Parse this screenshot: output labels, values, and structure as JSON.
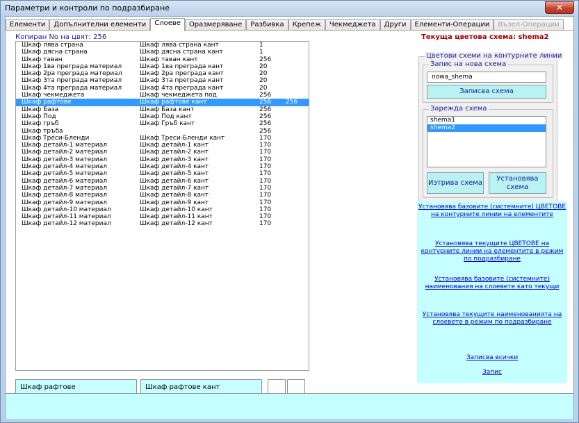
{
  "window": {
    "title": "Параметри и контроли по подразбиране",
    "close_label": "✕"
  },
  "tabs": [
    {
      "label": "Елементи",
      "active": false,
      "disabled": false
    },
    {
      "label": "Допълнителни елементи",
      "active": false,
      "disabled": false
    },
    {
      "label": "Слоеве",
      "active": true,
      "disabled": false
    },
    {
      "label": "Оразмеряване",
      "active": false,
      "disabled": false
    },
    {
      "label": "Разбивка",
      "active": false,
      "disabled": false
    },
    {
      "label": "Крепеж",
      "active": false,
      "disabled": false
    },
    {
      "label": "Чекмеджета",
      "active": false,
      "disabled": false
    },
    {
      "label": "Други",
      "active": false,
      "disabled": false
    },
    {
      "label": "Елементи-Операции",
      "active": false,
      "disabled": false
    },
    {
      "label": "Възел-Операции",
      "active": false,
      "disabled": true
    }
  ],
  "copied_label": "Копиран No на цвят:  256",
  "layers": [
    {
      "name": "Шкаф лява страна",
      "edge": "Шкаф лява страна кант",
      "color": "1",
      "copied": ""
    },
    {
      "name": "Шкаф дясна страна",
      "edge": "Шкаф дясна страна кант",
      "color": "1",
      "copied": ""
    },
    {
      "name": "Шкаф таван",
      "edge": "Шкаф таван кант",
      "color": "256",
      "copied": ""
    },
    {
      "name": "Шкаф 1ва преграда материал",
      "edge": "Шкаф 1ва преграда кант",
      "color": "20",
      "copied": ""
    },
    {
      "name": "Шкаф 2ра преграда материал",
      "edge": "Шкаф 2ра преграда кант",
      "color": "20",
      "copied": ""
    },
    {
      "name": "Шкаф 3та преграда материал",
      "edge": "Шкаф 3та преграда кант",
      "color": "20",
      "copied": ""
    },
    {
      "name": "Шкаф 4та преграда материал",
      "edge": "Шкаф 4та преграда кант",
      "color": "20",
      "copied": ""
    },
    {
      "name": "Шкаф чекмеджета",
      "edge": "Шкаф чекмеджета под",
      "color": "256",
      "copied": ""
    },
    {
      "name": "Шкаф рафтове",
      "edge": "Шкаф рафтове кант",
      "color": "256",
      "copied": "256"
    },
    {
      "name": "Шкаф База",
      "edge": "Шкаф База кант",
      "color": "256",
      "copied": ""
    },
    {
      "name": "Шкаф Под",
      "edge": "Шкаф Под кант",
      "color": "256",
      "copied": ""
    },
    {
      "name": "Шкаф гръб",
      "edge": "Шкаф Гръб кант",
      "color": "256",
      "copied": ""
    },
    {
      "name": "Шкаф тръба",
      "edge": "",
      "color": "256",
      "copied": ""
    },
    {
      "name": "Шкаф Треси-Бленди",
      "edge": "Шкаф Треси-Бленди кант",
      "color": "170",
      "copied": ""
    },
    {
      "name": "Шкаф детайл-1 материал",
      "edge": "Шкаф детайл-1 кант",
      "color": "170",
      "copied": ""
    },
    {
      "name": "Шкаф детайл-2 материал",
      "edge": "Шкаф детайл-2 кант",
      "color": "170",
      "copied": ""
    },
    {
      "name": "Шкаф детайл-3 материал",
      "edge": "Шкаф детайл-3 кант",
      "color": "170",
      "copied": ""
    },
    {
      "name": "Шкаф детайл-4 материал",
      "edge": "Шкаф детайл-4 кант",
      "color": "170",
      "copied": ""
    },
    {
      "name": "Шкаф детайл-5 материал",
      "edge": "Шкаф детайл-5 кант",
      "color": "170",
      "copied": ""
    },
    {
      "name": "Шкаф детайл-6 материал",
      "edge": "Шкаф детайл-6 кант",
      "color": "170",
      "copied": ""
    },
    {
      "name": "Шкаф детайл-7 материал",
      "edge": "Шкаф детайл-7 кант",
      "color": "170",
      "copied": ""
    },
    {
      "name": "Шкаф детайл-8 материал",
      "edge": "Шкаф детайл-8 кант",
      "color": "170",
      "copied": ""
    },
    {
      "name": "Шкаф детайл-9 материал",
      "edge": "Шкаф детайл-9 кант",
      "color": "170",
      "copied": ""
    },
    {
      "name": "Шкаф детайл-10 материал",
      "edge": "Шкаф детайл-10 кант",
      "color": "170",
      "copied": ""
    },
    {
      "name": "Шкаф детайл-11 материал",
      "edge": "Шкаф детайл-11 кант",
      "color": "170",
      "copied": ""
    },
    {
      "name": "Шкаф детайл-12 материал",
      "edge": "Шкаф детайл-12 кант",
      "color": "170",
      "copied": ""
    }
  ],
  "selected_index": 8,
  "details": {
    "layer_name": "Шкаф рафтове",
    "edge_name": "Шкаф рафтове кант"
  },
  "scheme": {
    "current_label": "Текуща цветова схема:  shema2",
    "group_title": "Цветови схеми на контурните линии",
    "new_group_title": "Запис на нова схема",
    "new_value": "nowa_shema",
    "save_button": "Записва схема",
    "load_group_title": "Зарежда схема",
    "schemes": [
      {
        "name": "shema1",
        "selected": false
      },
      {
        "name": "shema2",
        "selected": true
      }
    ],
    "delete_button": "Изтрива схема",
    "apply_button": "Установява схема"
  },
  "links": {
    "base_colors": "Установява базовите (системните) ЦВЕТОВЕ на контурните линии на елементите",
    "current_colors": "Установява текущите ЦВЕТОВЕ на контурните линии на елементите в режим по подразбиране",
    "base_names": "Установява базовите (системните) наименования на слоевете като текущи",
    "current_names": "Установява текущите наименованията на слоевете в режим по подразбиране",
    "save_all": "Записва всички",
    "save": "Запис"
  },
  "colors": {
    "cyan_panel": "#c6ffff",
    "selection": "#3399ff",
    "link": "#0000cc",
    "scheme_title": "#a00000"
  }
}
